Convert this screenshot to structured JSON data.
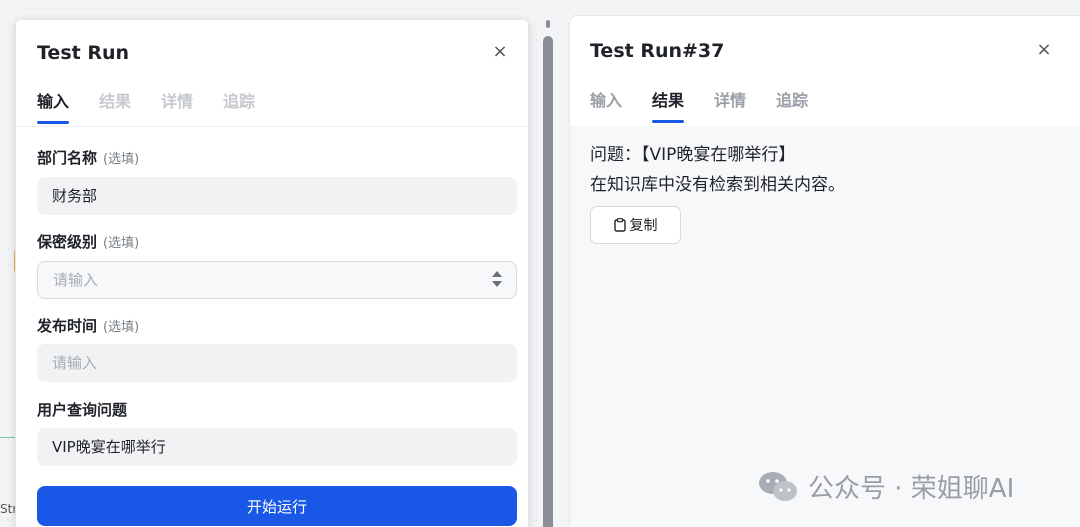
{
  "background": {
    "strip_label": "Str"
  },
  "left_panel": {
    "title": "Test Run",
    "close": "×",
    "tabs": [
      {
        "label": "输入",
        "active": true
      },
      {
        "label": "结果",
        "active": false
      },
      {
        "label": "详情",
        "active": false
      },
      {
        "label": "追踪",
        "active": false
      }
    ],
    "fields": {
      "dept": {
        "label": "部门名称",
        "optional": "(选填)",
        "value": "财务部",
        "placeholder": ""
      },
      "secret": {
        "label": "保密级别",
        "optional": "(选填)",
        "value": "",
        "placeholder": "请输入"
      },
      "publish": {
        "label": "发布时间",
        "optional": "(选填)",
        "value": "",
        "placeholder": "请输入"
      },
      "question": {
        "label": "用户查询问题",
        "value": "VIP晚宴在哪举行",
        "placeholder": ""
      }
    },
    "run_button": "开始运行"
  },
  "right_panel": {
    "title": "Test Run#37",
    "close": "×",
    "tabs": [
      {
        "label": "输入",
        "active": false
      },
      {
        "label": "结果",
        "active": true
      },
      {
        "label": "详情",
        "active": false
      },
      {
        "label": "追踪",
        "active": false
      }
    ],
    "result_line1": "问题：【VIP晚宴在哪举行】",
    "result_line2": "在知识库中没有检索到相关内容。",
    "copy_button": "复制"
  },
  "watermark": {
    "text": "公众号 · 荣姐聊AI"
  },
  "colors": {
    "accent": "#1958e6",
    "field_bg": "#f1f2f4"
  }
}
